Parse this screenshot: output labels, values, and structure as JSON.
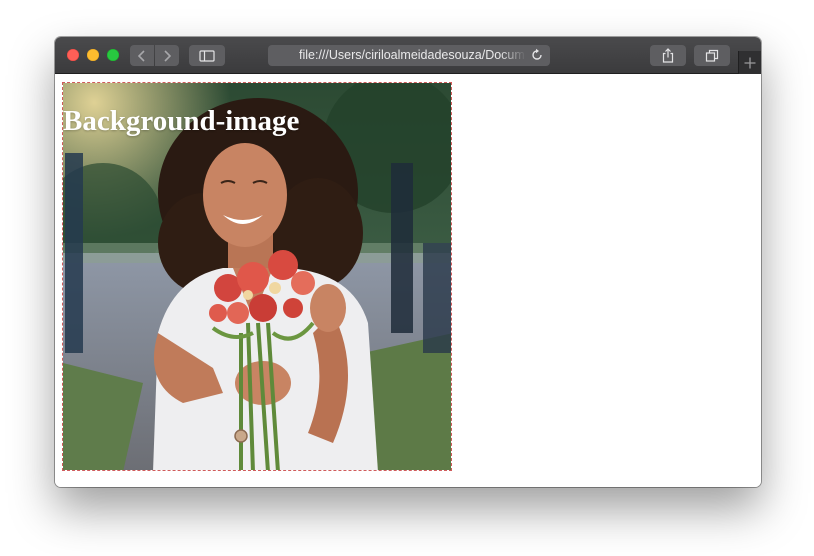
{
  "browser": {
    "address_url": "file:///Users/ciriloalmeidadesouza/Documents",
    "icons": {
      "back": "chevron-left-icon",
      "forward": "chevron-right-icon",
      "sidebar": "sidebar-icon",
      "reload": "reload-icon",
      "share": "share-icon",
      "tabs": "tabs-icon",
      "new_tab": "plus-icon"
    },
    "colors": {
      "close": "#fe5f57",
      "minimize": "#febc2e",
      "maximize": "#28c840",
      "toolbar": "#3b3b3d"
    }
  },
  "page": {
    "heading": "Background-image",
    "box_border_color": "#d05b5b"
  }
}
